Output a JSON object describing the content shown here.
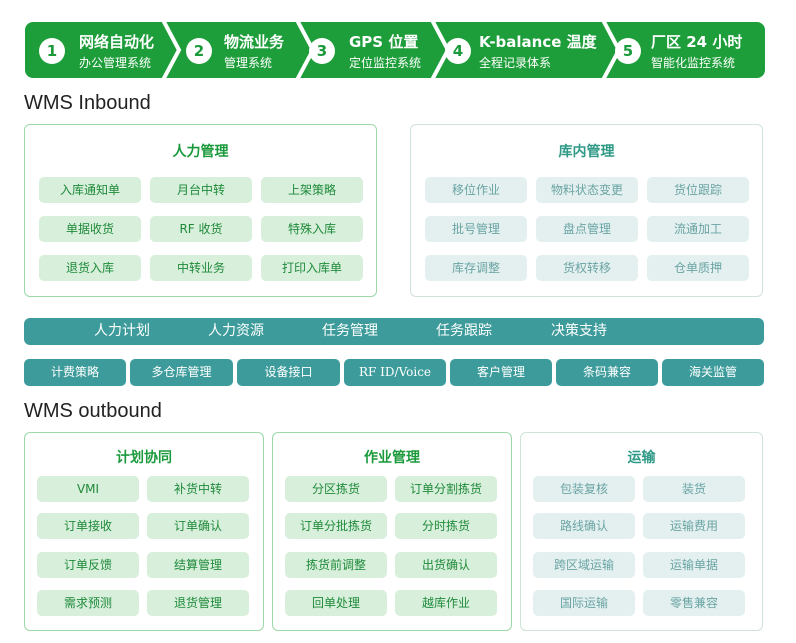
{
  "banner": {
    "steps": [
      {
        "num": "1",
        "title": "网络自动化",
        "sub": "办公管理系统"
      },
      {
        "num": "2",
        "title": "物流业务",
        "sub": "管理系统"
      },
      {
        "num": "3",
        "title": "GPS 位置",
        "sub": "定位监控系统"
      },
      {
        "num": "4",
        "title": "K-balance 温度",
        "sub": "全程记录体系"
      },
      {
        "num": "5",
        "title": "厂区 24 小时",
        "sub": "智能化监控系统"
      }
    ],
    "color": "#1e9e3a"
  },
  "inbound": {
    "title": "WMS Inbound",
    "manpower": {
      "title": "人力管理",
      "items": [
        "入库通知单",
        "月台中转",
        "上架策略",
        "单据收货",
        "RF 收货",
        "特殊入库",
        "退货入库",
        "中转业务",
        "打印入库单"
      ]
    },
    "warehouse": {
      "title": "库内管理",
      "items": [
        "移位作业",
        "物料状态变更",
        "货位跟踪",
        "批号管理",
        "盘点管理",
        "流通加工",
        "库存调整",
        "货权转移",
        "仓单质押"
      ]
    }
  },
  "middle": {
    "bar": [
      "人力计划",
      "人力资源",
      "任务管理",
      "任务跟踪",
      "决策支持"
    ],
    "chips": [
      "计费策略",
      "多仓库管理",
      "设备接口",
      "RF ID/Voice",
      "客户管理",
      "条码兼容",
      "海关监管"
    ],
    "color": "#3d9c9b"
  },
  "outbound": {
    "title": "WMS outbound",
    "plan": {
      "title": "计划协同",
      "items": [
        "VMI",
        "补货中转",
        "订单接收",
        "订单确认",
        "订单反馈",
        "结算管理",
        "需求预测",
        "退货管理"
      ]
    },
    "ops": {
      "title": "作业管理",
      "items": [
        "分区拣货",
        "订单分割拣货",
        "订单分批拣货",
        "分时拣货",
        "拣货前调整",
        "出货确认",
        "回单处理",
        "越库作业"
      ]
    },
    "transport": {
      "title": "运输",
      "items": [
        "包装复核",
        "装货",
        "路线确认",
        "运输费用",
        "跨区域运输",
        "运输单据",
        "国际运输",
        "零售兼容"
      ]
    }
  }
}
